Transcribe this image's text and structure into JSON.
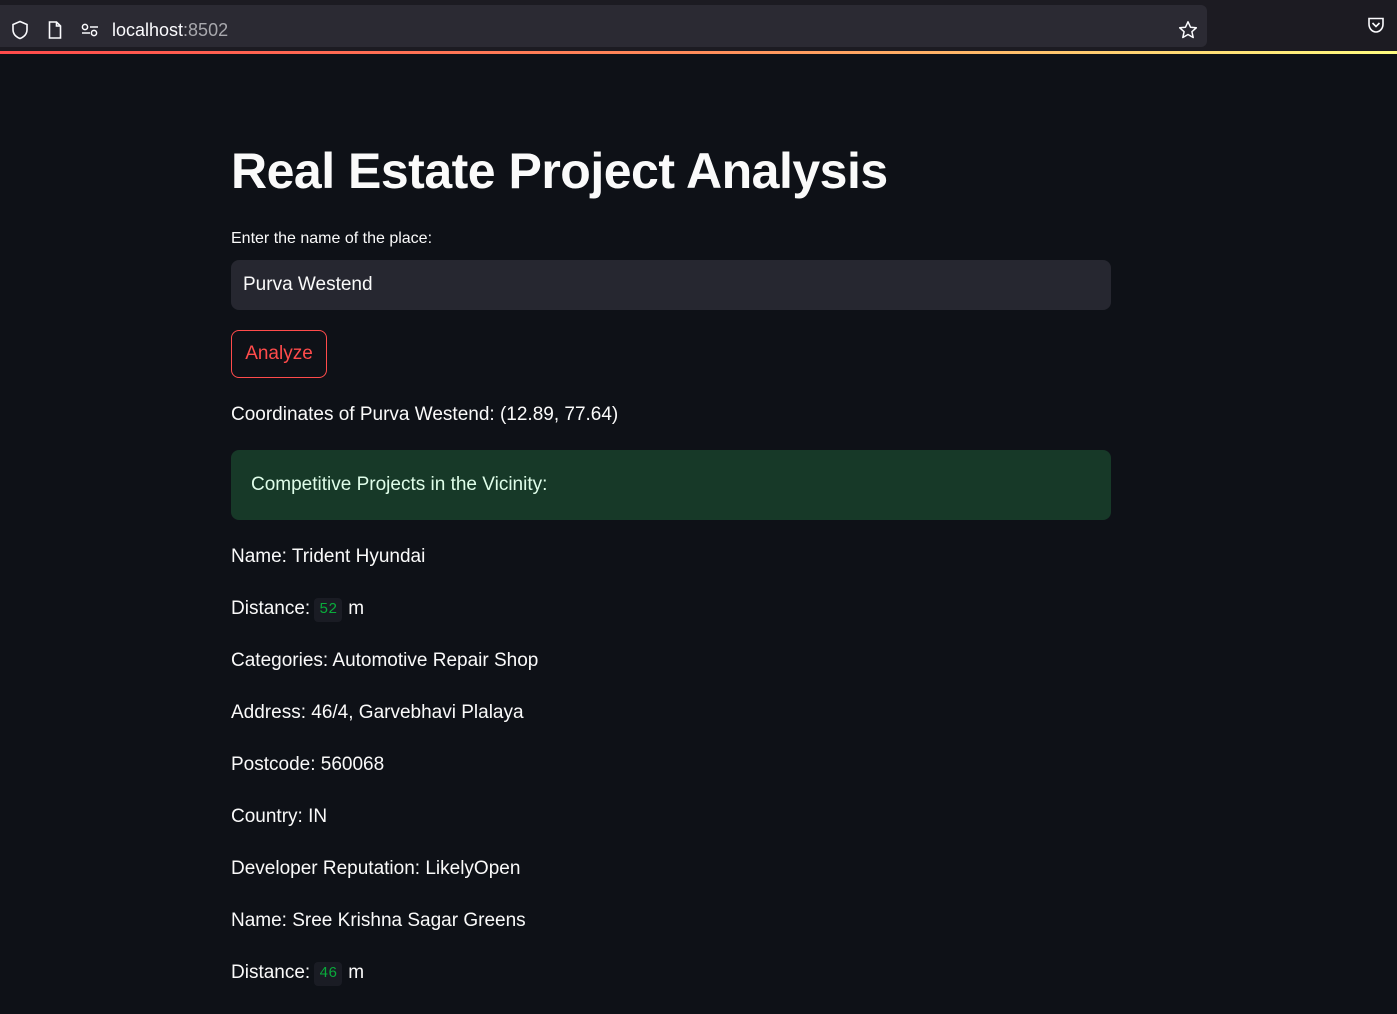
{
  "browser": {
    "url_host": "localhost",
    "url_port": ":8502",
    "icons": [
      "shield-icon",
      "page-icon",
      "permissions-icon",
      "bookmark-star-icon",
      "pocket-icon"
    ]
  },
  "app": {
    "title": "Real Estate Project Analysis",
    "input_label": "Enter the name of the place:",
    "input_value": "Purva Westend",
    "analyze_label": "Analyze",
    "coordinates_text": "Coordinates of Purva Westend: (12.89, 77.64)",
    "success_text": "Competitive Projects in the Vicinity:",
    "accent_color": "#ff4b4b",
    "success_bg": "#173928"
  },
  "projects": [
    {
      "name": "Name: Trident Hyundai",
      "distance_prefix": "Distance:",
      "distance_value": "52",
      "distance_unit": "m",
      "categories": "Categories: Automotive Repair Shop",
      "address": "Address: 46/4, Garvebhavi Plalaya",
      "postcode": "Postcode: 560068",
      "country": "Country: IN",
      "reputation": "Developer Reputation: LikelyOpen"
    },
    {
      "name": "Name: Sree Krishna Sagar Greens",
      "distance_prefix": "Distance:",
      "distance_value": "46",
      "distance_unit": "m"
    }
  ]
}
